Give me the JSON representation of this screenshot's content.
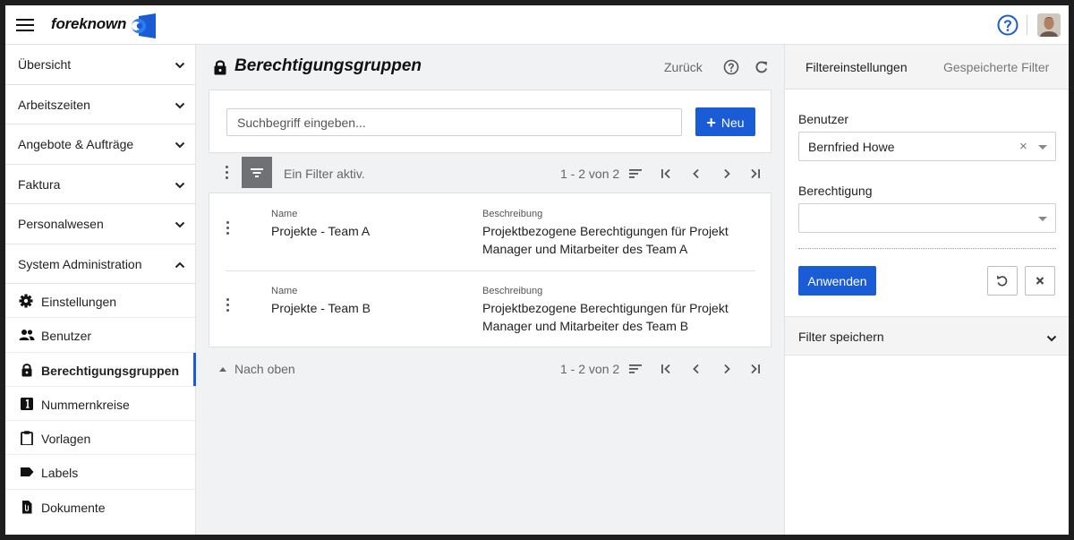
{
  "app": {
    "name": "foreknown",
    "brand_color": "#1a5bd6"
  },
  "sidebar": {
    "groups": [
      {
        "label": "Übersicht",
        "expanded": false
      },
      {
        "label": "Arbeitszeiten",
        "expanded": false
      },
      {
        "label": "Angebote & Aufträge",
        "expanded": false
      },
      {
        "label": "Faktura",
        "expanded": false
      },
      {
        "label": "Personalwesen",
        "expanded": false
      },
      {
        "label": "System Administration",
        "expanded": true
      }
    ],
    "items": [
      {
        "label": "Einstellungen",
        "icon": "gear-icon"
      },
      {
        "label": "Benutzer",
        "icon": "users-icon"
      },
      {
        "label": "Berechtigungsgruppen",
        "icon": "lock-icon",
        "active": true
      },
      {
        "label": "Nummernkreise",
        "icon": "number-one-icon"
      },
      {
        "label": "Vorlagen",
        "icon": "clipboard-icon"
      },
      {
        "label": "Labels",
        "icon": "label-icon"
      },
      {
        "label": "Dokumente",
        "icon": "document-icon"
      }
    ]
  },
  "page": {
    "title": "Berechtigungsgruppen",
    "back_label": "Zurück"
  },
  "search": {
    "placeholder": "Suchbegriff eingeben...",
    "value": "",
    "new_label": "Neu"
  },
  "toolbar": {
    "filter_status": "Ein Filter aktiv.",
    "pager": "1 - 2 von 2"
  },
  "list": {
    "rows": [
      {
        "name_label": "Name",
        "name": "Projekte - Team A",
        "desc_label": "Beschreibung",
        "desc_line1": "Projektbezogene Berechtigungen für Projekt",
        "desc_line2": "Manager und Mitarbeiter des Team A"
      },
      {
        "name_label": "Name",
        "name": "Projekte - Team B",
        "desc_label": "Beschreibung",
        "desc_line1": "Projektbezogene Berechtigungen für Projekt",
        "desc_line2": "Manager und Mitarbeiter des Team B"
      }
    ]
  },
  "footer": {
    "top_label": "Nach oben",
    "pager": "1 - 2 von 2"
  },
  "filter_panel": {
    "tabs": [
      {
        "label": "Filtereinstellungen",
        "active": true
      },
      {
        "label": "Gespeicherte Filter",
        "active": false
      }
    ],
    "user_label": "Benutzer",
    "user_value": "Bernfried Howe",
    "permission_label": "Berechtigung",
    "permission_value": "",
    "apply_label": "Anwenden",
    "save_label": "Filter speichern"
  }
}
